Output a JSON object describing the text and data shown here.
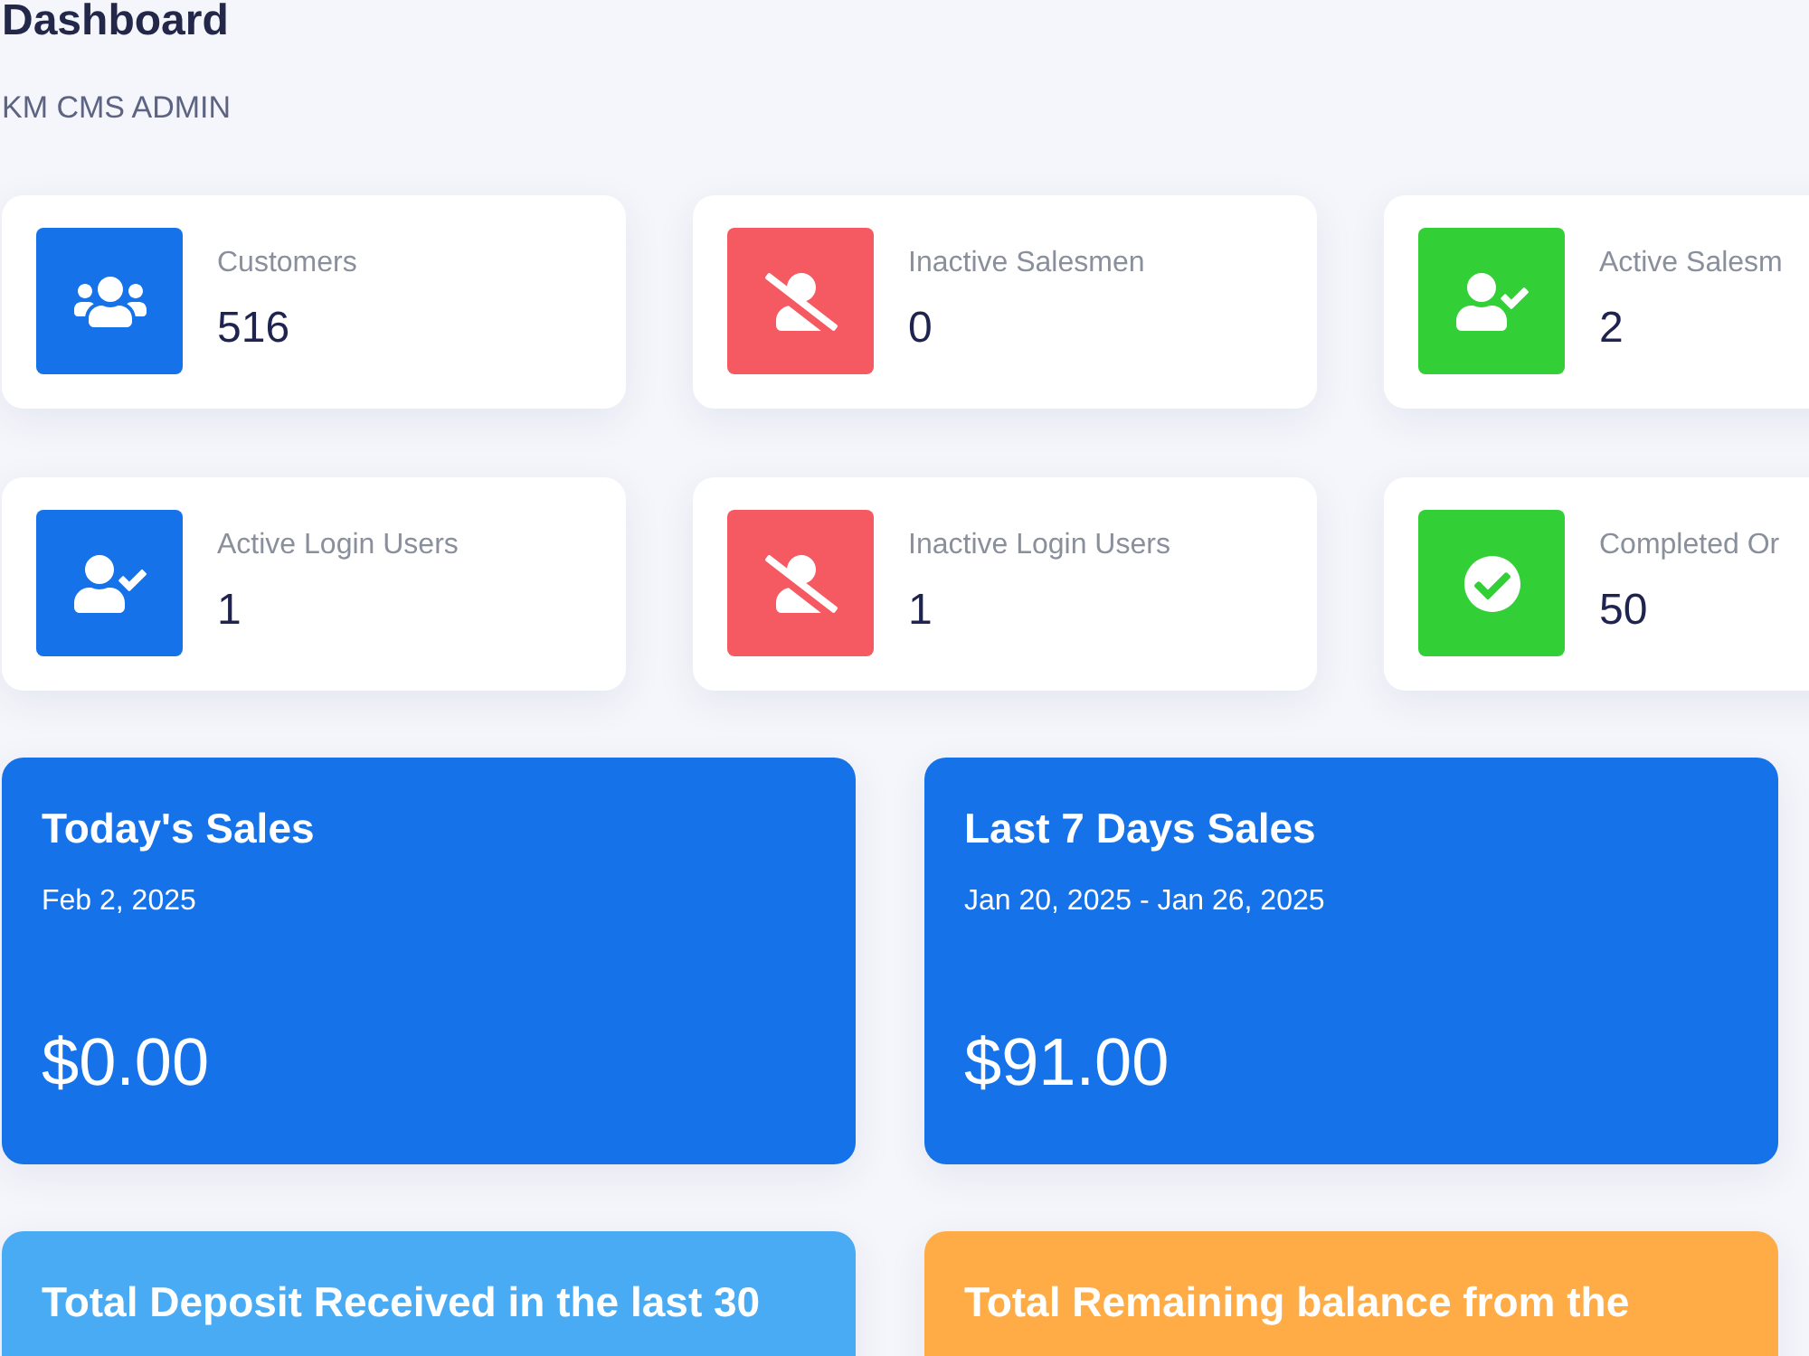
{
  "page": {
    "title": "Dashboard",
    "subtitle": "KM CMS ADMIN"
  },
  "stat_cards": [
    {
      "kind": "users",
      "color": "#1672e8",
      "label": "Customers",
      "value": "516"
    },
    {
      "kind": "user-slash",
      "color": "#f55a62",
      "label": "Inactive Salesmen",
      "value": "0"
    },
    {
      "kind": "user-check",
      "color": "#33cf37",
      "label": "Active Salesm",
      "value": "2"
    },
    {
      "kind": "user-check",
      "color": "#1672e8",
      "label": "Active Login Users",
      "value": "1"
    },
    {
      "kind": "user-slash",
      "color": "#f55a62",
      "label": "Inactive Login Users",
      "value": "1"
    },
    {
      "kind": "check-circle",
      "color": "#33cf37",
      "label": "Completed Or",
      "value": "50"
    }
  ],
  "summary_cards": [
    {
      "color": "#1672e8",
      "title": "Today's Sales",
      "date": "Feb 2, 2025",
      "amount": "$0.00"
    },
    {
      "color": "#1672e8",
      "title": "Last 7 Days Sales",
      "date": "Jan 20, 2025 - Jan 26, 2025",
      "amount": "$91.00"
    },
    {
      "color": "#4aabf5",
      "title": "Total Deposit Received in the last 30"
    },
    {
      "color": "#ffac47",
      "title": "Total Remaining balance from the"
    }
  ]
}
